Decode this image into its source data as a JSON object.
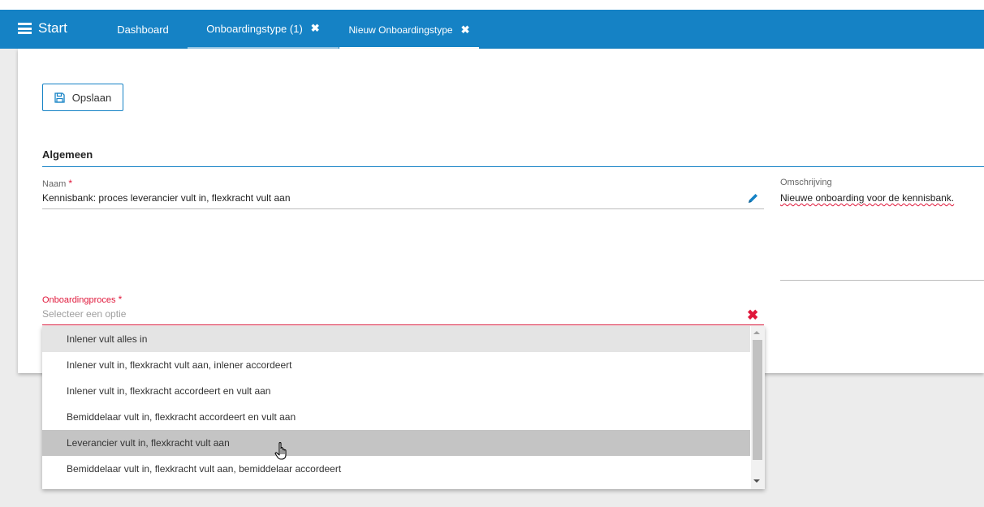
{
  "topbar": {
    "start_label": "Start",
    "tabs": [
      {
        "label": "Dashboard",
        "closable": false
      },
      {
        "label": "Onboardingstype (1)",
        "closable": true
      },
      {
        "label": "Nieuw Onboardingstype",
        "closable": true,
        "active": true
      }
    ],
    "close_glyph": "✖",
    "color": "#1582c5"
  },
  "toolbar": {
    "save_label": "Opslaan",
    "save_icon": "save-icon"
  },
  "section": {
    "title": "Algemeen"
  },
  "form": {
    "naam": {
      "label": "Naam",
      "required_mark": "*",
      "value": "Kennisbank: proces leverancier vult in, flexkracht vult aan",
      "icon": "pencil-icon"
    },
    "omschrijving": {
      "label": "Omschrijving",
      "value": "Nieuwe onboarding voor de kennisbank."
    },
    "onboardingproces": {
      "label": "Onboardingproces",
      "required_mark": "*",
      "placeholder": "Selecteer een optie",
      "clear_icon": "close-icon",
      "options": [
        "Inlener vult alles in",
        "Inlener vult in, flexkracht vult aan, inlener accordeert",
        "Inlener vult in, flexkracht accordeert en vult aan",
        "Bemiddelaar vult in, flexkracht accordeert en vult aan",
        "Leverancier vult in, flexkracht vult aan",
        "Bemiddelaar vult in, flexkracht vult aan, bemiddelaar accordeert"
      ],
      "hovered_option": "Leverancier vult in, flexkracht vult aan"
    }
  },
  "colors": {
    "accent": "#1582c5",
    "error": "#e0173a"
  }
}
